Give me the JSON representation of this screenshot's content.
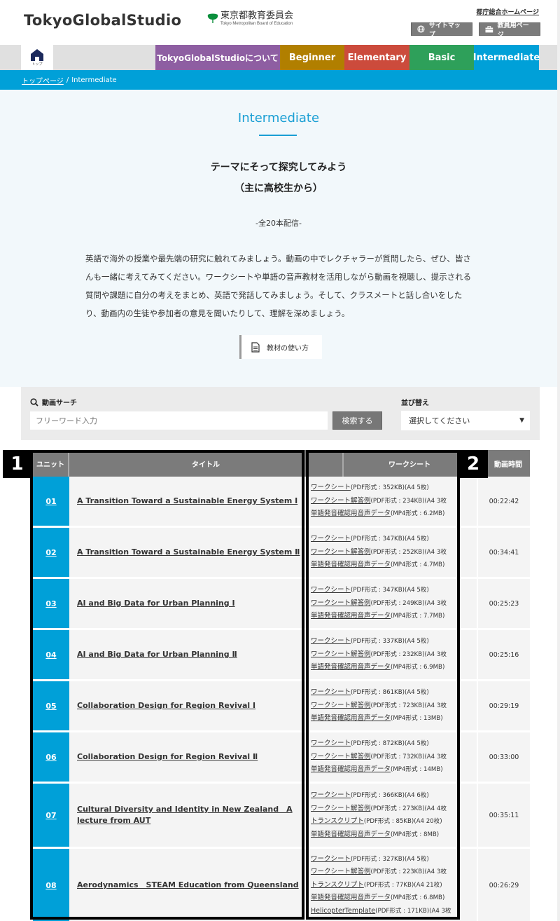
{
  "header": {
    "logo": "TokyoGlobalStudio",
    "board_ja": "東京都教育委員会",
    "board_en": "Tokyo Metropolitan Board of Education",
    "gov_link": "都庁総合ホームページ",
    "sitemap": "サイトマップ",
    "teacher_page": "教員用ページ"
  },
  "nav": {
    "home_label": "トップ",
    "tabs": [
      {
        "label": "TokyoGlobalStudioについて",
        "color": "#8e5ea2"
      },
      {
        "label": "Beginner",
        "color": "#b17f00"
      },
      {
        "label": "Elementary",
        "color": "#cc4b3c"
      },
      {
        "label": "Basic",
        "color": "#2ea05a"
      },
      {
        "label": "Intermediate",
        "color": "#00a0d8",
        "active": true
      }
    ]
  },
  "breadcrumb": {
    "home": "トップページ",
    "separator": "/",
    "current": "Intermediate"
  },
  "hero": {
    "title": "Intermediate",
    "subtitle1": "テーマにそって探究してみよう",
    "subtitle2": "（主に高校生から）",
    "count": "-全20本配信-",
    "description": "英語で海外の授業や最先端の研究に触れてみましょう。動画の中でレクチャラーが質問したら、ぜひ、皆さんも一緒に考えてみてください。ワークシートや単語の音声教材を活用しながら動画を視聴し、提示される質問や課題に自分の考えをまとめ、英語で発話してみましょう。そして、クラスメートと話し合いをしたり、動画内の生徒や参加者の意見を聞いたりして、理解を深めましょう。",
    "howto_button": "教材の使い方"
  },
  "search": {
    "label": "動画サーチ",
    "placeholder": "フリーワード入力",
    "button": "検索する",
    "sort_label": "並び替え",
    "sort_value": "選択してください"
  },
  "table": {
    "headers": {
      "unit": "ユニット",
      "title": "タイトル",
      "worksheet": "ワークシート",
      "duration": "動画時間"
    },
    "rows": [
      {
        "unit": "01",
        "title": "A Transition Toward a Sustainable Energy System Ⅰ",
        "duration": "00:22:42",
        "files": [
          {
            "link": "ワークシート",
            "info": "(PDF形式 : 352KB)(A4 5枚)"
          },
          {
            "link": "ワークシート解答例",
            "info": "(PDF形式 : 234KB)(A4 3枚"
          },
          {
            "link": "単語発音確認用音声データ",
            "info": "(MP4形式 : 6.2MB)"
          }
        ]
      },
      {
        "unit": "02",
        "title": "A Transition Toward a Sustainable Energy System Ⅱ",
        "duration": "00:34:41",
        "files": [
          {
            "link": "ワークシート",
            "info": "(PDF形式 : 347KB)(A4 5枚)"
          },
          {
            "link": "ワークシート解答例",
            "info": "(PDF形式 : 252KB)(A4 3枚"
          },
          {
            "link": "単語発音確認用音声データ",
            "info": "(MP4形式 : 4.7MB)"
          }
        ]
      },
      {
        "unit": "03",
        "title": "AI and Big Data for Urban Planning Ⅰ",
        "duration": "00:25:23",
        "files": [
          {
            "link": "ワークシート",
            "info": "(PDF形式 : 347KB)(A4 5枚)"
          },
          {
            "link": "ワークシート解答例",
            "info": "(PDF形式 : 249KB)(A4 3枚"
          },
          {
            "link": "単語発音確認用音声データ",
            "info": "(MP4形式 : 7.7MB)"
          }
        ]
      },
      {
        "unit": "04",
        "title": "AI and Big Data for Urban Planning Ⅱ",
        "duration": "00:25:16",
        "files": [
          {
            "link": "ワークシート",
            "info": "(PDF形式 : 337KB)(A4 5枚)"
          },
          {
            "link": "ワークシート解答例",
            "info": "(PDF形式 : 232KB)(A4 3枚"
          },
          {
            "link": "単語発音確認用音声データ",
            "info": "(MP4形式 : 6.9MB)"
          }
        ]
      },
      {
        "unit": "05",
        "title": "Collaboration Design for Region Revival Ⅰ",
        "duration": "00:29:19",
        "files": [
          {
            "link": "ワークシート",
            "info": "(PDF形式 : 861KB)(A4 5枚)"
          },
          {
            "link": "ワークシート解答例",
            "info": "(PDF形式 : 723KB)(A4 3枚"
          },
          {
            "link": "単語発音確認用音声データ",
            "info": "(MP4形式 : 13MB)"
          }
        ]
      },
      {
        "unit": "06",
        "title": "Collaboration Design for Region Revival Ⅱ",
        "duration": "00:33:00",
        "files": [
          {
            "link": "ワークシート",
            "info": "(PDF形式 : 872KB)(A4 5枚)"
          },
          {
            "link": "ワークシート解答例",
            "info": "(PDF形式 : 732KB)(A4 3枚"
          },
          {
            "link": "単語発音確認用音声データ",
            "info": "(MP4形式 : 14MB)"
          }
        ]
      },
      {
        "unit": "07",
        "title": "Cultural Diversity and Identity in New Zealand　A lecture from AUT",
        "duration": "00:35:11",
        "files": [
          {
            "link": "ワークシート",
            "info": "(PDF形式 : 366KB)(A4 6枚)"
          },
          {
            "link": "ワークシート解答例",
            "info": "(PDF形式 : 273KB)(A4 4枚"
          },
          {
            "link": "トランスクリプト",
            "info": "(PDF形式 : 85KB)(A4 20枚)"
          },
          {
            "link": "単語発音確認用音声データ",
            "info": "(MP4形式 : 8MB)"
          }
        ]
      },
      {
        "unit": "08",
        "title": "Aerodynamics　STEAM Education from Queensland",
        "duration": "00:26:29",
        "files": [
          {
            "link": "ワークシート",
            "info": "(PDF形式 : 327KB)(A4 5枚)"
          },
          {
            "link": "ワークシート解答例",
            "info": "(PDF形式 : 223KB)(A4 3枚"
          },
          {
            "link": "トランスクリプト",
            "info": "(PDF形式 : 77KB)(A4 21枚)"
          },
          {
            "link": "単語発音確認用音声データ",
            "info": "(MP4形式 : 6.8MB)"
          },
          {
            "link": "HelicopterTemplate",
            "info": "(PDF形式 : 171KB)(A4 3枚"
          }
        ]
      }
    ]
  },
  "annotations": {
    "box1": "1",
    "box2": "2"
  }
}
